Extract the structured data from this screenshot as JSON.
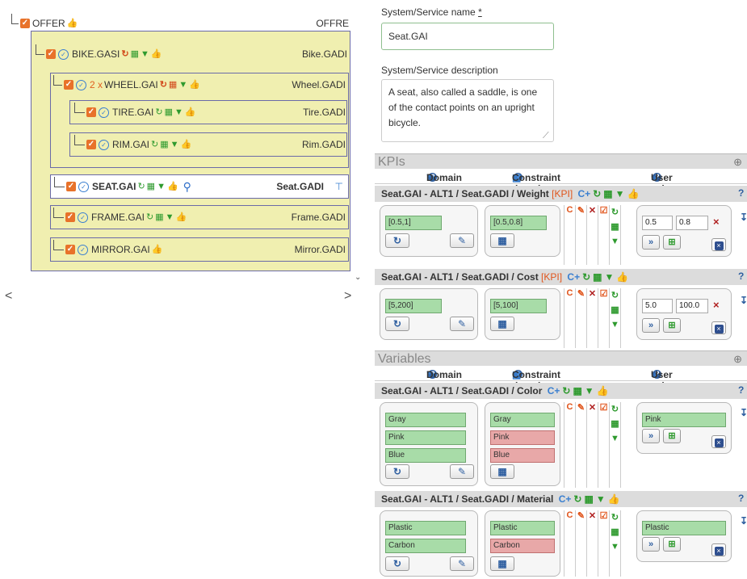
{
  "tree": {
    "root": {
      "label": "OFFER",
      "code": "OFFRE"
    },
    "bike": {
      "label": "BIKE.GASI",
      "code": "Bike.GADI"
    },
    "wheel": {
      "mult": "2 x",
      "label": "WHEEL.GAI",
      "code": "Wheel.GADI"
    },
    "tire": {
      "label": "TIRE.GAI",
      "code": "Tire.GADI"
    },
    "rim": {
      "label": "RIM.GAI",
      "code": "Rim.GADI"
    },
    "seat": {
      "label": "SEAT.GAI",
      "code": "Seat.GADI"
    },
    "frame": {
      "label": "FRAME.GAI",
      "code": "Frame.GADI"
    },
    "mirror": {
      "label": "MIRROR.GAI",
      "code": "Mirror.GADI"
    },
    "scroll_left": "<",
    "scroll_right": ">"
  },
  "form": {
    "name_label": "System/Service name",
    "required_mark": "*",
    "name_value": "Seat.GAI",
    "desc_label": "System/Service description",
    "desc_value": "A seat, also called a saddle, is one of the contact points on an upright bicycle."
  },
  "columns": {
    "domain": "Domain",
    "constraint": "Constraint domain",
    "user": "User values"
  },
  "kpis": {
    "title": "KPIs",
    "items": [
      {
        "header": "Seat.GAI - ALT1 / Seat.GADI / Weight",
        "tag": "[KPI]",
        "domain": "[0.5,1]",
        "constraint": "[0.5,0.8]",
        "user_min": "0.5",
        "user_max": "0.8"
      },
      {
        "header": "Seat.GAI - ALT1 / Seat.GADI / Cost",
        "tag": "[KPI]",
        "domain": "[5,200]",
        "constraint": "[5,100]",
        "user_min": "5.0",
        "user_max": "100.0"
      }
    ]
  },
  "variables": {
    "title": "Variables",
    "items": [
      {
        "header": "Seat.GAI - ALT1 / Seat.GADI / Color",
        "domain": [
          "Gray",
          "Pink",
          "Blue"
        ],
        "constraint": [
          "Gray",
          "Pink",
          "Blue"
        ],
        "user": "Pink"
      },
      {
        "header": "Seat.GAI - ALT1 / Seat.GADI / Material",
        "domain": [
          "Plastic",
          "Carbon"
        ],
        "constraint": [
          "Plastic",
          "Carbon"
        ],
        "user": "Plastic"
      }
    ]
  },
  "icons": {
    "accent_orange": "#e8722a",
    "accent_green": "#2e9a2e",
    "accent_blue": "#3a7fd0"
  }
}
